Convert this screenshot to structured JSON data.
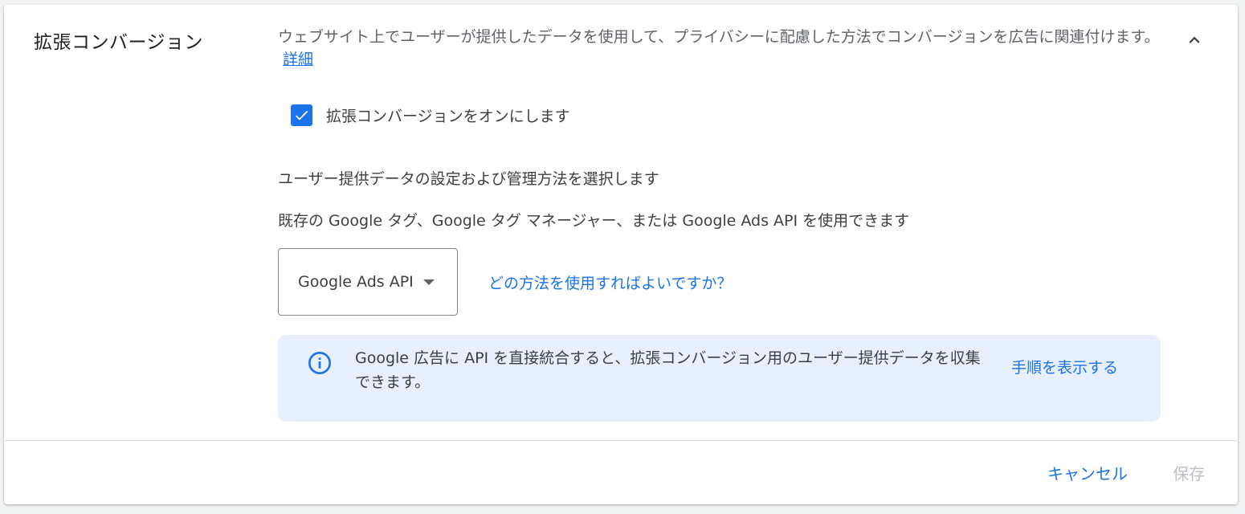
{
  "section": {
    "title": "拡張コンバージョン",
    "description": "ウェブサイト上でユーザーが提供したデータを使用して、プライバシーに配慮した方法でコンバージョンを広告に関連付けます。",
    "learn_more": "詳細",
    "collapse_icon": "chevron-up-icon"
  },
  "checkbox": {
    "checked": true,
    "label": "拡張コンバージョンをオンにします"
  },
  "setup": {
    "heading": "ユーザー提供データの設定および管理方法を選択します",
    "helper": "既存の Google タグ、Google タグ マネージャー、または Google Ads API を使用できます",
    "select_value": "Google Ads API",
    "method_link": "どの方法を使用すればよいですか？"
  },
  "info": {
    "icon": "info-icon",
    "text": "Google 広告に API を直接統合すると、拡張コンバージョン用のユーザー提供データを収集できます。",
    "link": "手順を表示する"
  },
  "footer": {
    "cancel": "キャンセル",
    "save": "保存"
  },
  "colors": {
    "accent": "#1a73e8",
    "banner_bg": "#e8f0fe",
    "disabled": "#bdc1c6"
  }
}
